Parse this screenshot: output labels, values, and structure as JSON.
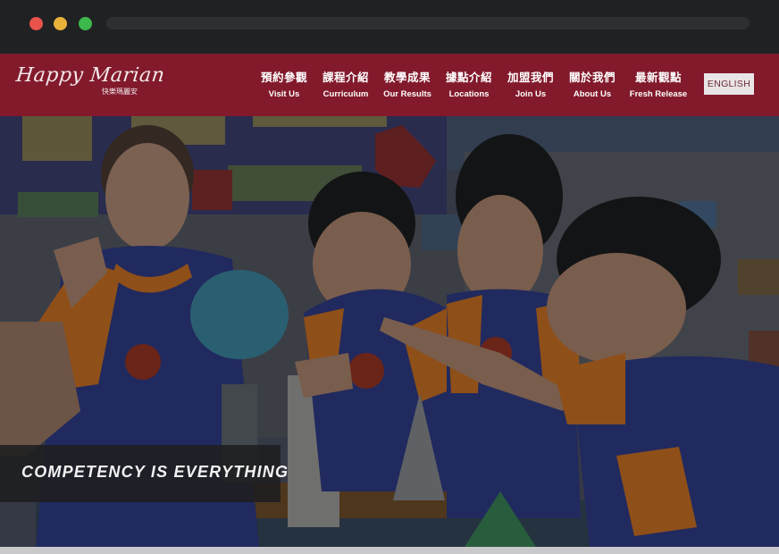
{
  "browser": {
    "window_buttons": [
      "close",
      "minimize",
      "maximize"
    ]
  },
  "logo": {
    "main": "Happy Marian",
    "sub": "快樂瑪麗安"
  },
  "nav": [
    {
      "zh": "預約參觀",
      "en": "Visit Us"
    },
    {
      "zh": "課程介紹",
      "en": "Curriculum"
    },
    {
      "zh": "教學成果",
      "en": "Our Results"
    },
    {
      "zh": "據點介紹",
      "en": "Locations"
    },
    {
      "zh": "加盟我們",
      "en": "Join Us"
    },
    {
      "zh": "關於我們",
      "en": "About Us"
    },
    {
      "zh": "最新觀點",
      "en": "Fresh Release"
    }
  ],
  "language_button": "ENGLISH",
  "hero": {
    "tagline": "COMPETENCY IS EVERYTHING"
  },
  "colors": {
    "header_bg": "#821a2c",
    "chrome_bg": "#202123",
    "shirt_blue": "#2d3a8a",
    "shirt_orange": "#d9782a"
  }
}
